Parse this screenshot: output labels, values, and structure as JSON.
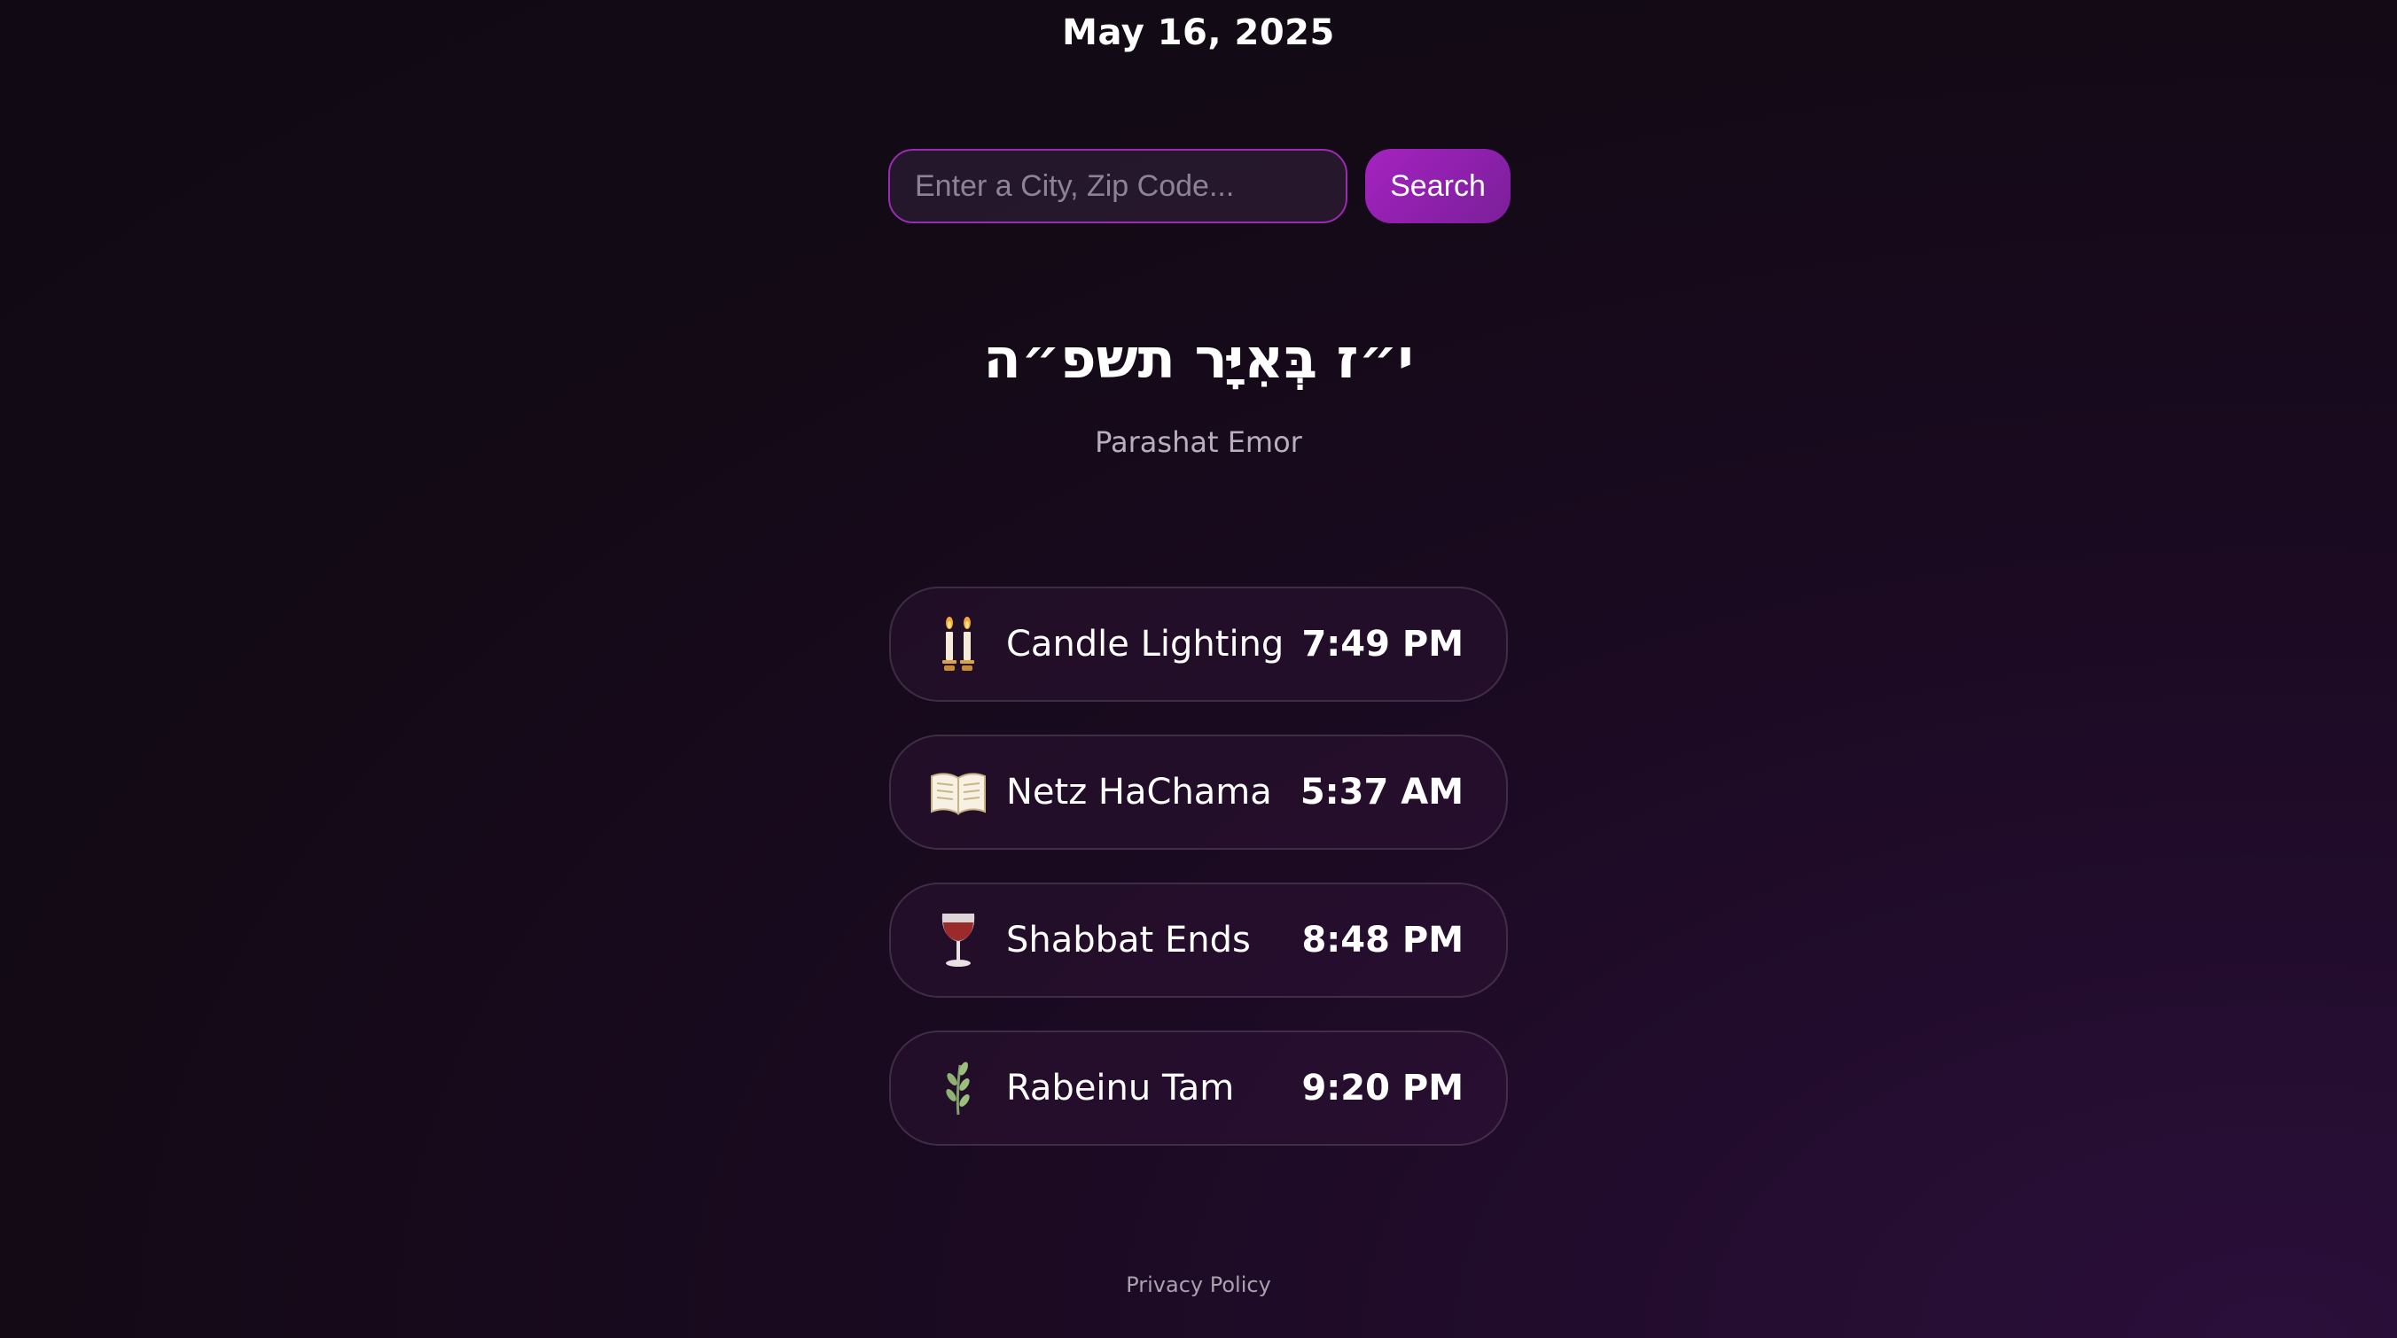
{
  "header": {
    "date": "May 16, 2025"
  },
  "search": {
    "placeholder": "Enter a City, Zip Code...",
    "value": "",
    "button_label": "Search"
  },
  "hebrew": {
    "date": "י״ז בְּאִיָּר תשפ״ה",
    "parasha": "Parashat Emor"
  },
  "times": [
    {
      "icon": "candles-icon",
      "label": "Candle Lighting",
      "time": "7:49 PM"
    },
    {
      "icon": "open-book-icon",
      "label": "Netz HaChama",
      "time": "5:37 AM"
    },
    {
      "icon": "wine-glass-icon",
      "label": "Shabbat Ends",
      "time": "8:48 PM"
    },
    {
      "icon": "herb-icon",
      "label": "Rabeinu Tam",
      "time": "9:20 PM"
    }
  ],
  "footer": {
    "privacy_label": "Privacy Policy"
  },
  "colors": {
    "accent": "#a522c0",
    "background": "#120a14",
    "card_border": "#3a2a40"
  }
}
